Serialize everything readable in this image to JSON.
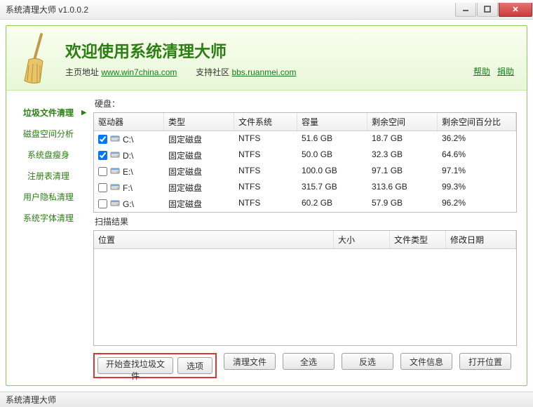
{
  "window": {
    "title": "系统清理大师 v1.0.0.2"
  },
  "header": {
    "title": "欢迎使用系统清理大师",
    "homepage_label": "主页地址",
    "homepage_url": "www.win7china.com",
    "community_label": "支持社区",
    "community_url": "bbs.ruanmei.com",
    "help": "帮助",
    "donate": "捐助"
  },
  "sidebar": {
    "items": [
      {
        "label": "垃圾文件清理",
        "active": true
      },
      {
        "label": "磁盘空间分析",
        "active": false
      },
      {
        "label": "系统盘瘦身",
        "active": false
      },
      {
        "label": "注册表清理",
        "active": false
      },
      {
        "label": "用户隐私清理",
        "active": false
      },
      {
        "label": "系统字体清理",
        "active": false
      }
    ]
  },
  "disks": {
    "section_label": "硬盘：",
    "columns": {
      "drive": "驱动器",
      "type": "类型",
      "fs": "文件系统",
      "cap": "容量",
      "free": "剩余空间",
      "pct": "剩余空间百分比"
    },
    "rows": [
      {
        "checked": true,
        "name": "C:\\",
        "type": "固定磁盘",
        "fs": "NTFS",
        "cap": "51.6 GB",
        "free": "18.7 GB",
        "pct": "36.2%"
      },
      {
        "checked": true,
        "name": "D:\\",
        "type": "固定磁盘",
        "fs": "NTFS",
        "cap": "50.0 GB",
        "free": "32.3 GB",
        "pct": "64.6%"
      },
      {
        "checked": false,
        "name": "E:\\",
        "type": "固定磁盘",
        "fs": "NTFS",
        "cap": "100.0 GB",
        "free": "97.1 GB",
        "pct": "97.1%"
      },
      {
        "checked": false,
        "name": "F:\\",
        "type": "固定磁盘",
        "fs": "NTFS",
        "cap": "315.7 GB",
        "free": "313.6 GB",
        "pct": "99.3%"
      },
      {
        "checked": false,
        "name": "G:\\",
        "type": "固定磁盘",
        "fs": "NTFS",
        "cap": "60.2 GB",
        "free": "57.9 GB",
        "pct": "96.2%"
      }
    ]
  },
  "results": {
    "section_label": "扫描结果",
    "columns": {
      "location": "位置",
      "size": "大小",
      "ftype": "文件类型",
      "date": "修改日期"
    }
  },
  "buttons": {
    "start_scan": "开始查找垃圾文件",
    "options": "选项",
    "clean": "清理文件",
    "select_all": "全选",
    "invert": "反选",
    "file_info": "文件信息",
    "open_location": "打开位置"
  },
  "status": {
    "text": "系统清理大师"
  }
}
